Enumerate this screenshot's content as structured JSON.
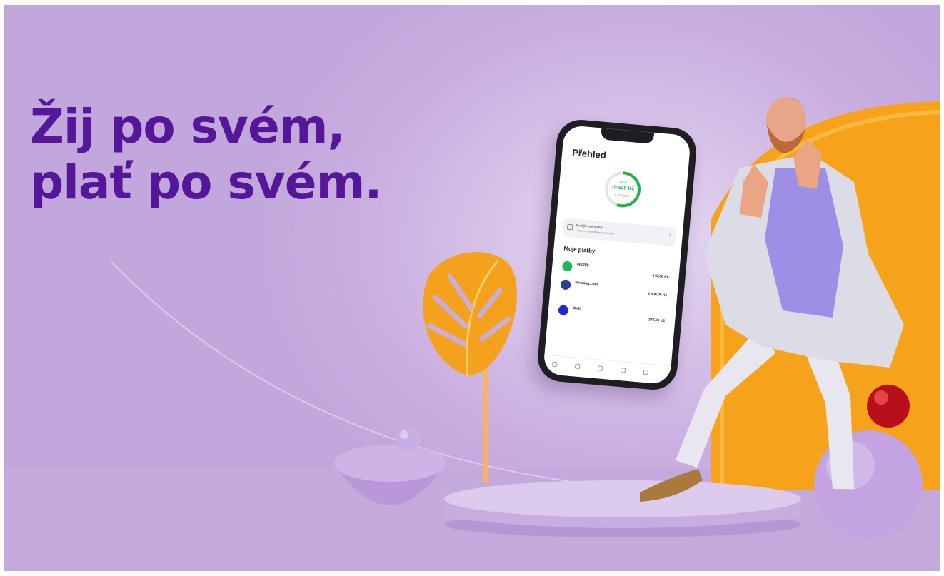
{
  "headline": {
    "line1": "Žij po svém,",
    "line2": "plať po svém."
  },
  "colors": {
    "headline": "#55169a",
    "background": "#c8aee0",
    "accent_orange": "#f7a21b",
    "accent_green": "#22b34a"
  },
  "phone": {
    "title": "Přehled",
    "ring_top": "Zbývá",
    "ring_amount": "10 625 Kč",
    "ring_sub": "z 20 000 Kč",
    "ring_progress": 0.53,
    "promo_text": "Použijte své platby",
    "promo_sub": "a všechny další inforace na kartách",
    "section": "Moje platby",
    "payments": [
      {
        "name": "Spotify",
        "amount": "149,00 Kč",
        "color": "#1db954"
      },
      {
        "name": "Booking.com",
        "amount": "3 500,00 Kč",
        "color": "#2d3e9b"
      },
      {
        "name": "Wolt",
        "amount": "276,00 Kč",
        "color": "#1f2ad6"
      }
    ],
    "nav_icons": [
      "home-icon",
      "wallet-icon",
      "card-icon",
      "bag-icon",
      "more-icon"
    ]
  }
}
